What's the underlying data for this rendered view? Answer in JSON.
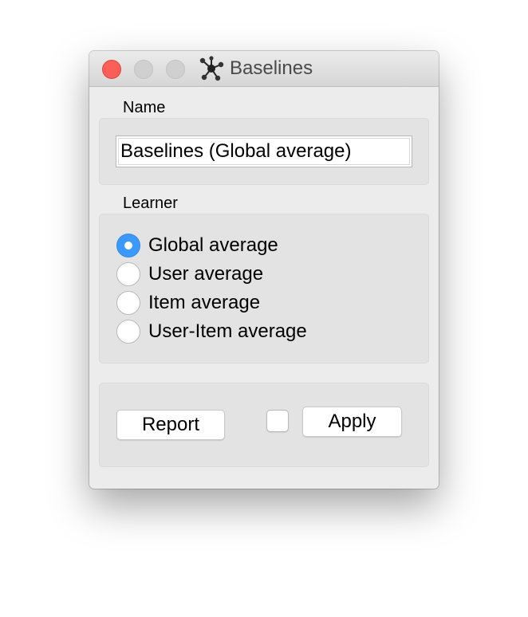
{
  "window": {
    "title": "Baselines",
    "icon": "orange-widget-network-icon"
  },
  "name_group": {
    "label": "Name",
    "value": "Baselines (Global average)"
  },
  "learner_group": {
    "label": "Learner",
    "options": [
      {
        "label": "Global average",
        "selected": true
      },
      {
        "label": "User average",
        "selected": false
      },
      {
        "label": "Item average",
        "selected": false
      },
      {
        "label": "User-Item average",
        "selected": false
      }
    ]
  },
  "footer": {
    "report_label": "Report",
    "auto_apply_checked": false,
    "apply_label": "Apply"
  },
  "colors": {
    "accent": "#3b99fc",
    "close": "#fc5f57",
    "window_bg": "#ececec",
    "group_bg": "#e3e3e3"
  }
}
